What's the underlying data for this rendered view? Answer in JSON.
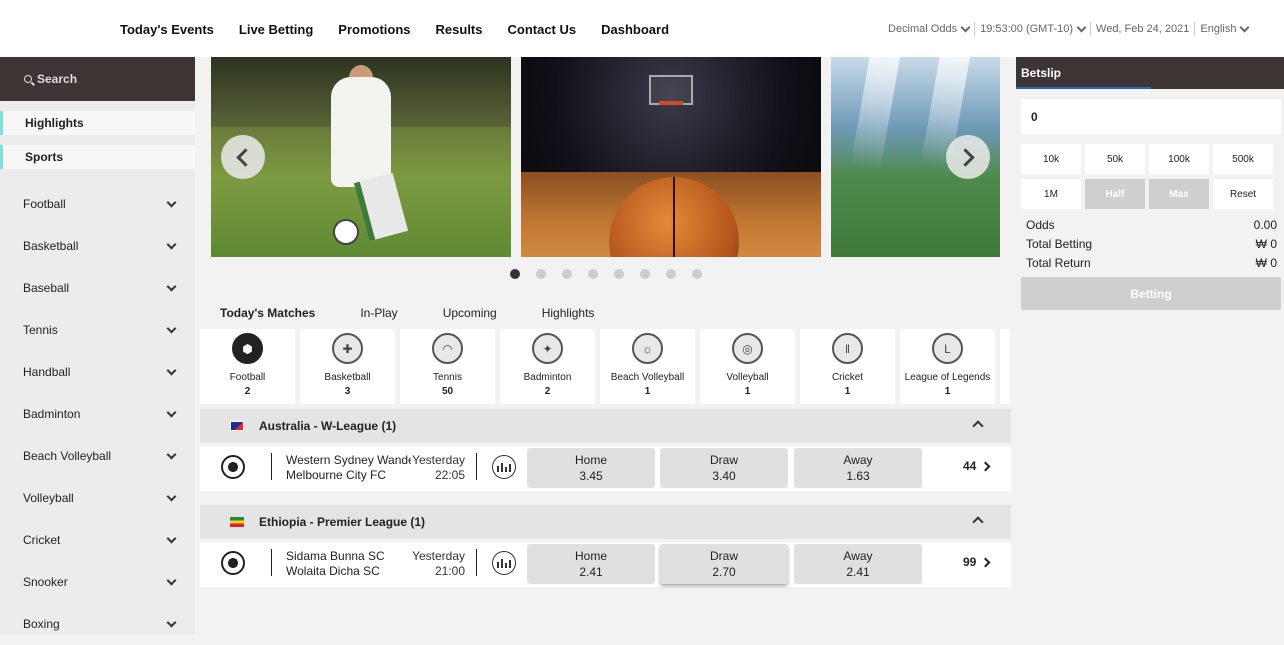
{
  "nav": {
    "items": [
      "Today's Events",
      "Live Betting",
      "Promotions",
      "Results",
      "Contact Us",
      "Dashboard"
    ]
  },
  "top_right": {
    "odds_format": "Decimal Odds",
    "clock": "19:53:00 (GMT-10)",
    "date": "Wed, Feb 24, 2021",
    "language": "English"
  },
  "sidebar": {
    "search_label": "Search",
    "highlights": "Highlights",
    "sports_heading": "Sports",
    "sports": [
      "Football",
      "Basketball",
      "Baseball",
      "Tennis",
      "Handball",
      "Badminton",
      "Beach Volleyball",
      "Volleyball",
      "Cricket",
      "Snooker",
      "Boxing"
    ]
  },
  "carousel": {
    "slide_count": 8,
    "active_index": 0
  },
  "tabs": [
    "Today's Matches",
    "In-Play",
    "Upcoming",
    "Highlights"
  ],
  "sport_cards": [
    {
      "name": "Football",
      "count": "2",
      "icon": "football-icon"
    },
    {
      "name": "Basketball",
      "count": "3",
      "icon": "basketball-icon"
    },
    {
      "name": "Tennis",
      "count": "50",
      "icon": "tennis-icon"
    },
    {
      "name": "Badminton",
      "count": "2",
      "icon": "badminton-icon"
    },
    {
      "name": "Beach Volleyball",
      "count": "1",
      "icon": "beach-volleyball-icon"
    },
    {
      "name": "Volleyball",
      "count": "1",
      "icon": "volleyball-icon"
    },
    {
      "name": "Cricket",
      "count": "1",
      "icon": "cricket-icon"
    },
    {
      "name": "League of Legends",
      "count": "1",
      "icon": "league-of-legends-icon"
    }
  ],
  "leagues": [
    {
      "name": "Australia - W-League (1)",
      "flag": "australia-flag-icon",
      "match": {
        "home_team": "Western Sydney Wanderers",
        "away_team": "Melbourne City FC",
        "day": "Yesterday",
        "time": "22:05",
        "home_label": "Home",
        "home_odds": "3.45",
        "draw_label": "Draw",
        "draw_odds": "3.40",
        "away_label": "Away",
        "away_odds": "1.63",
        "more_markets": "44"
      }
    },
    {
      "name": "Ethiopia - Premier League (1)",
      "flag": "ethiopia-flag-icon",
      "match": {
        "home_team": "Sidama Bunna SC",
        "away_team": "Wolaita Dicha SC",
        "day": "Yesterday",
        "time": "21:00",
        "home_label": "Home",
        "home_odds": "2.41",
        "draw_label": "Draw",
        "draw_odds": "2.70",
        "away_label": "Away",
        "away_odds": "2.41",
        "more_markets": "99"
      }
    }
  ],
  "betslip": {
    "title": "Betslip",
    "amount": "0",
    "quick_buttons": [
      "10k",
      "50k",
      "100k",
      "500k",
      "1M",
      "Half",
      "Max",
      "Reset"
    ],
    "odds_label": "Odds",
    "odds_value": "0.00",
    "total_betting_label": "Total Betting",
    "total_betting_value": "₩ 0",
    "total_return_label": "Total Return",
    "total_return_value": "₩ 0",
    "submit_label": "Betting"
  }
}
